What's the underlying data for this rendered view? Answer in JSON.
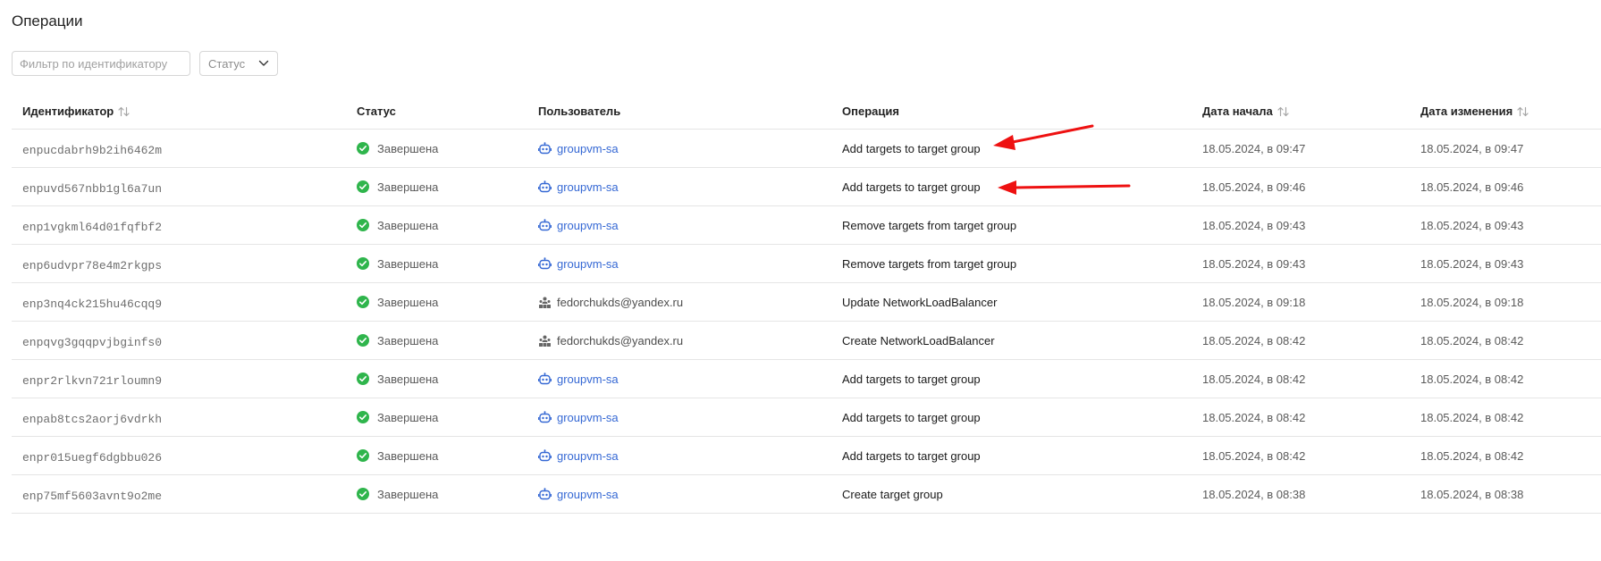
{
  "page": {
    "title": "Операции"
  },
  "filters": {
    "id_placeholder": "Фильтр по идентификатору",
    "status_placeholder": "Статус"
  },
  "table": {
    "columns": {
      "id": "Идентификатор",
      "status": "Статус",
      "user": "Пользователь",
      "operation": "Операция",
      "started": "Дата начала",
      "modified": "Дата изменения"
    },
    "rows": [
      {
        "id": "enpucdabrh9b2ih6462m",
        "status": "Завершена",
        "user": "groupvm-sa",
        "user_type": "service-account",
        "operation": "Add targets to target group",
        "started": "18.05.2024, в 09:47",
        "modified": "18.05.2024, в 09:47"
      },
      {
        "id": "enpuvd567nbb1gl6a7un",
        "status": "Завершена",
        "user": "groupvm-sa",
        "user_type": "service-account",
        "operation": "Add targets to target group",
        "started": "18.05.2024, в 09:46",
        "modified": "18.05.2024, в 09:46"
      },
      {
        "id": "enp1vgkml64d01fqfbf2",
        "status": "Завершена",
        "user": "groupvm-sa",
        "user_type": "service-account",
        "operation": "Remove targets from target group",
        "started": "18.05.2024, в 09:43",
        "modified": "18.05.2024, в 09:43"
      },
      {
        "id": "enp6udvpr78e4m2rkgps",
        "status": "Завершена",
        "user": "groupvm-sa",
        "user_type": "service-account",
        "operation": "Remove targets from target group",
        "started": "18.05.2024, в 09:43",
        "modified": "18.05.2024, в 09:43"
      },
      {
        "id": "enp3nq4ck215hu46cqq9",
        "status": "Завершена",
        "user": "fedorchukds@yandex.ru",
        "user_type": "user",
        "operation": "Update NetworkLoadBalancer",
        "started": "18.05.2024, в 09:18",
        "modified": "18.05.2024, в 09:18"
      },
      {
        "id": "enpqvg3gqqpvjbginfs0",
        "status": "Завершена",
        "user": "fedorchukds@yandex.ru",
        "user_type": "user",
        "operation": "Create NetworkLoadBalancer",
        "started": "18.05.2024, в 08:42",
        "modified": "18.05.2024, в 08:42"
      },
      {
        "id": "enpr2rlkvn721rloumn9",
        "status": "Завершена",
        "user": "groupvm-sa",
        "user_type": "service-account",
        "operation": "Add targets to target group",
        "started": "18.05.2024, в 08:42",
        "modified": "18.05.2024, в 08:42"
      },
      {
        "id": "enpab8tcs2aorj6vdrkh",
        "status": "Завершена",
        "user": "groupvm-sa",
        "user_type": "service-account",
        "operation": "Add targets to target group",
        "started": "18.05.2024, в 08:42",
        "modified": "18.05.2024, в 08:42"
      },
      {
        "id": "enpr015uegf6dgbbu026",
        "status": "Завершена",
        "user": "groupvm-sa",
        "user_type": "service-account",
        "operation": "Add targets to target group",
        "started": "18.05.2024, в 08:42",
        "modified": "18.05.2024, в 08:42"
      },
      {
        "id": "enp75mf5603avnt9o2me",
        "status": "Завершена",
        "user": "groupvm-sa",
        "user_type": "service-account",
        "operation": "Create target group",
        "started": "18.05.2024, в 08:38",
        "modified": "18.05.2024, в 08:38"
      }
    ]
  },
  "icons": {
    "status": "check-circle-icon",
    "service_account": "robot-icon",
    "user": "user-group-icon",
    "sort": "sort-arrows-icon",
    "select": "chevron-down-icon"
  },
  "colors": {
    "success": "#2fb54c",
    "link": "#3568d4",
    "annotation_arrow": "#ee1111"
  }
}
